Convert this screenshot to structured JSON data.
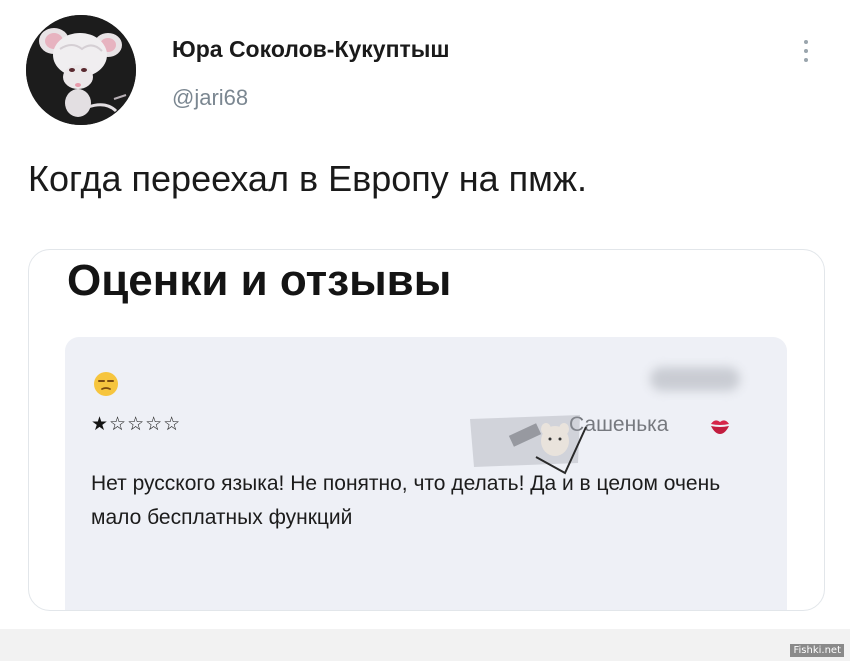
{
  "tweet": {
    "author_name": "Юра Соколов-Кукуптыш",
    "author_handle": "@jari68",
    "text": "Когда переехал в Европу на пмж."
  },
  "card": {
    "title": "Оценки и отзывы",
    "review": {
      "emoji": "unamused-face-icon",
      "rating": 1,
      "max_rating": 5,
      "stars_text": "★☆☆☆☆",
      "reviewer": "Сашенька",
      "reviewer_icon": "kiss-mark-icon",
      "text": "Нет русского языка! Не понятно, что делать! Да и в целом очень мало бесплатных функций"
    }
  },
  "watermark": {
    "site": "Fishki.net"
  },
  "colors": {
    "handle": "#7b8791",
    "review_bg": "#eef0f6",
    "reviewer": "#76797f",
    "kiss": "#d6264a"
  }
}
